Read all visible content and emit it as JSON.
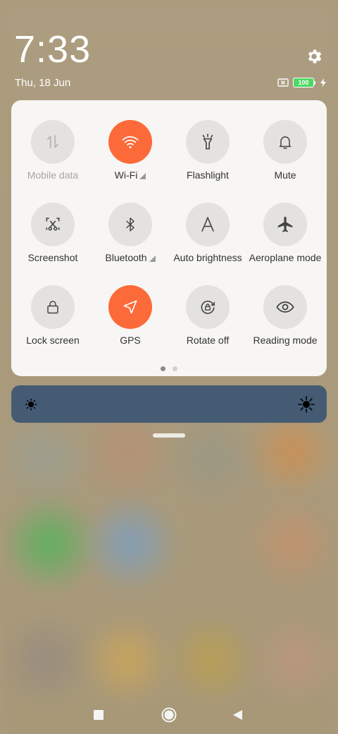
{
  "status": {
    "time": "7:33",
    "date": "Thu, 18 Jun",
    "battery_level": "100",
    "icons": [
      "no-sim-icon",
      "battery-icon",
      "charging-bolt-icon",
      "gear-icon"
    ]
  },
  "colors": {
    "active_tile": "#fc6a39",
    "inactive_tile": "#e3e2df",
    "panel": "#f7f6f4",
    "brightness_bar": "#455b73",
    "battery": "#4cd964"
  },
  "quick_settings": {
    "tiles": [
      {
        "label": "Mobile data",
        "icon": "mobile-data-icon",
        "active": false,
        "disabled": true
      },
      {
        "label": "Wi-Fi",
        "icon": "wifi-icon",
        "active": true,
        "expand": true
      },
      {
        "label": "Flashlight",
        "icon": "flashlight-icon",
        "active": false
      },
      {
        "label": "Mute",
        "icon": "bell-icon",
        "active": false
      },
      {
        "label": "Screenshot",
        "icon": "screenshot-icon",
        "active": false
      },
      {
        "label": "Bluetooth",
        "icon": "bluetooth-icon",
        "active": false,
        "expand": true
      },
      {
        "label": "Auto brightness",
        "icon": "auto-brightness-icon",
        "active": false
      },
      {
        "label": "Aeroplane mode",
        "icon": "aeroplane-icon",
        "active": false
      },
      {
        "label": "Lock screen",
        "icon": "lock-icon",
        "active": false
      },
      {
        "label": "GPS",
        "icon": "location-icon",
        "active": true
      },
      {
        "label": "Rotate off",
        "icon": "rotation-lock-icon",
        "active": false
      },
      {
        "label": "Reading mode",
        "icon": "eye-icon",
        "active": false
      }
    ],
    "page_count": 2,
    "current_page": 1
  },
  "brightness": {
    "level": 0.0,
    "icons": [
      "brightness-low-icon",
      "brightness-high-icon"
    ]
  },
  "navigation": {
    "buttons": [
      "recents-button",
      "home-button",
      "back-button"
    ]
  }
}
